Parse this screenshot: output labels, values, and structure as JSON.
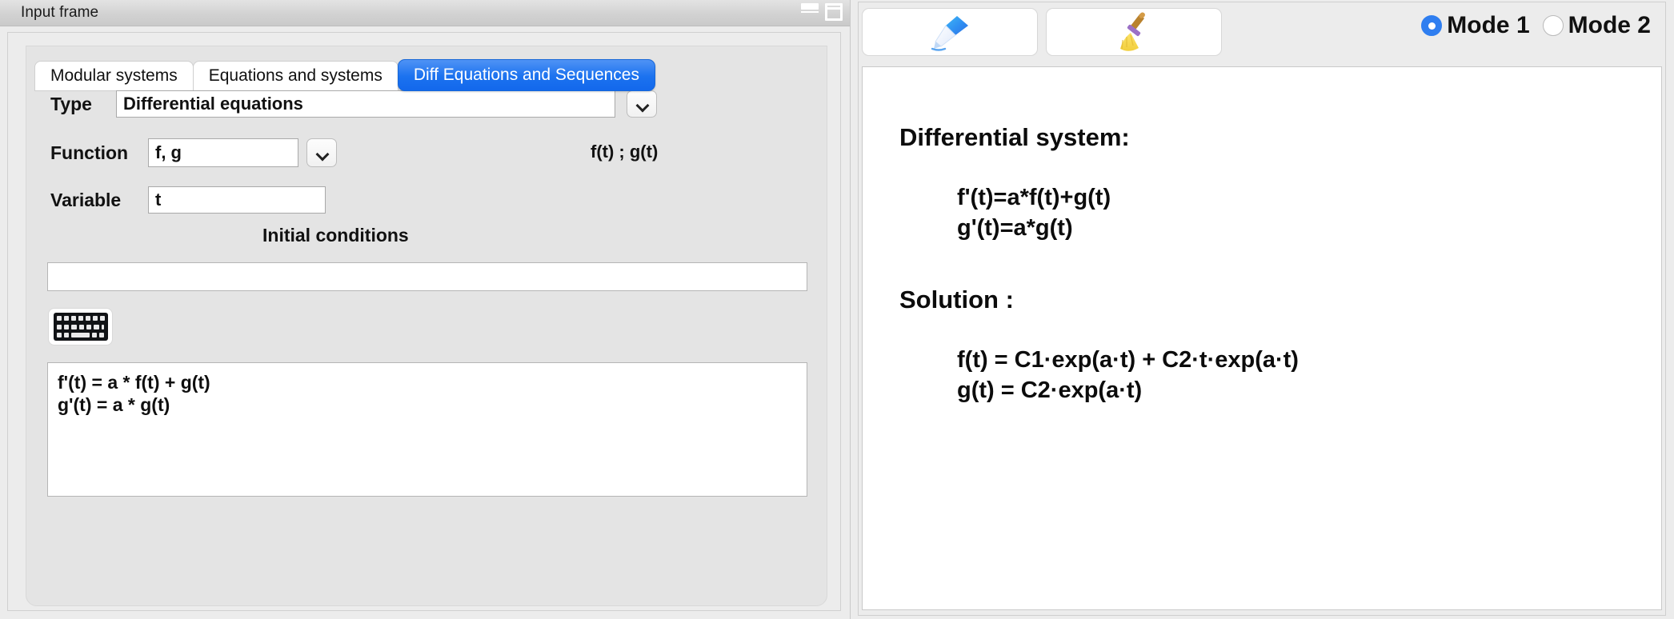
{
  "window": {
    "title": "Input frame",
    "minimize_icon": "minimize-icon",
    "maximize_icon": "maximize-icon"
  },
  "tabs": [
    {
      "label": "Modular systems",
      "active": false
    },
    {
      "label": "Equations and systems",
      "active": false
    },
    {
      "label": "Diff Equations and Sequences",
      "active": true
    }
  ],
  "form": {
    "type_label": "Type",
    "type_value": "Differential equations",
    "type_placeholder": "",
    "function_label": "Function",
    "function_value": "f, g",
    "function_placeholder": "",
    "function_hint": "f(t) ; g(t)",
    "variable_label": "Variable",
    "variable_value": "t",
    "variable_placeholder": "",
    "initial_conditions_label": "Initial conditions",
    "initial_conditions_value": "",
    "initial_conditions_placeholder": "",
    "keyboard_button_icon": "keyboard-icon",
    "equations_value": "f'(t) = a * f(t) + g(t)\ng'(t) = a * g(t)",
    "equations_placeholder": ""
  },
  "toolbar": {
    "solve_button_icon": "pen-icon",
    "clear_button_icon": "broom-icon"
  },
  "modes": {
    "mode1_label": "Mode 1",
    "mode2_label": "Mode 2",
    "selected": "Mode 1"
  },
  "result": {
    "system_heading": "Differential system:",
    "system_equations": "f'(t)=a*f(t)+g(t)\ng'(t)=a*g(t)",
    "solution_heading": "Solution :",
    "solution_equations": "f(t) = C1·exp(a·t) + C2·t·exp(a·t)\ng(t) = C2·exp(a·t)"
  },
  "colors": {
    "accent_blue": "#1b72ef",
    "radio_blue": "#2f7ef0",
    "panel_gray": "#e4e4e4",
    "window_gray": "#ececec"
  }
}
